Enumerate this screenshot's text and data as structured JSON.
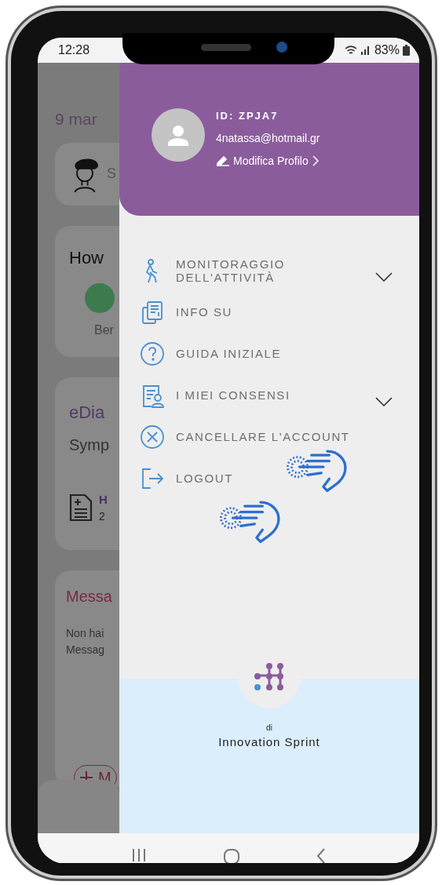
{
  "status_bar": {
    "time": "12:28",
    "battery": "83%"
  },
  "background_screen": {
    "date": "9 mar",
    "assistant_label": "S",
    "mood_card": {
      "title": "How",
      "option": "Ber"
    },
    "diary_card": {
      "title": "eDia",
      "subtitle": "Symp",
      "entry_title": "H",
      "entry_date": "2"
    },
    "messages_card": {
      "title": "Messa",
      "lines": [
        "Non hai",
        "Messag"
      ],
      "button": "M"
    }
  },
  "drawer": {
    "profile": {
      "id_label": "ID: ZPJA7",
      "email": "4natassa@hotmail.gr",
      "edit_link": "Modifica Profilo"
    },
    "menu": [
      {
        "kind": "activity",
        "label": "MONITORAGGIO DELL'ATTIVITÀ",
        "expandable": true
      },
      {
        "kind": "info",
        "label": "INFO SU",
        "expandable": false
      },
      {
        "kind": "guide",
        "label": "GUIDA INIZIALE",
        "expandable": false
      },
      {
        "kind": "consents",
        "label": "I MIEI CONSENSI",
        "expandable": true
      },
      {
        "kind": "delete",
        "label": "CANCELLARE L'ACCOUNT",
        "expandable": false
      },
      {
        "kind": "logout",
        "label": "LOGOUT",
        "expandable": false
      }
    ],
    "footer": {
      "by": "di",
      "company": "Innovation Sprint"
    }
  }
}
